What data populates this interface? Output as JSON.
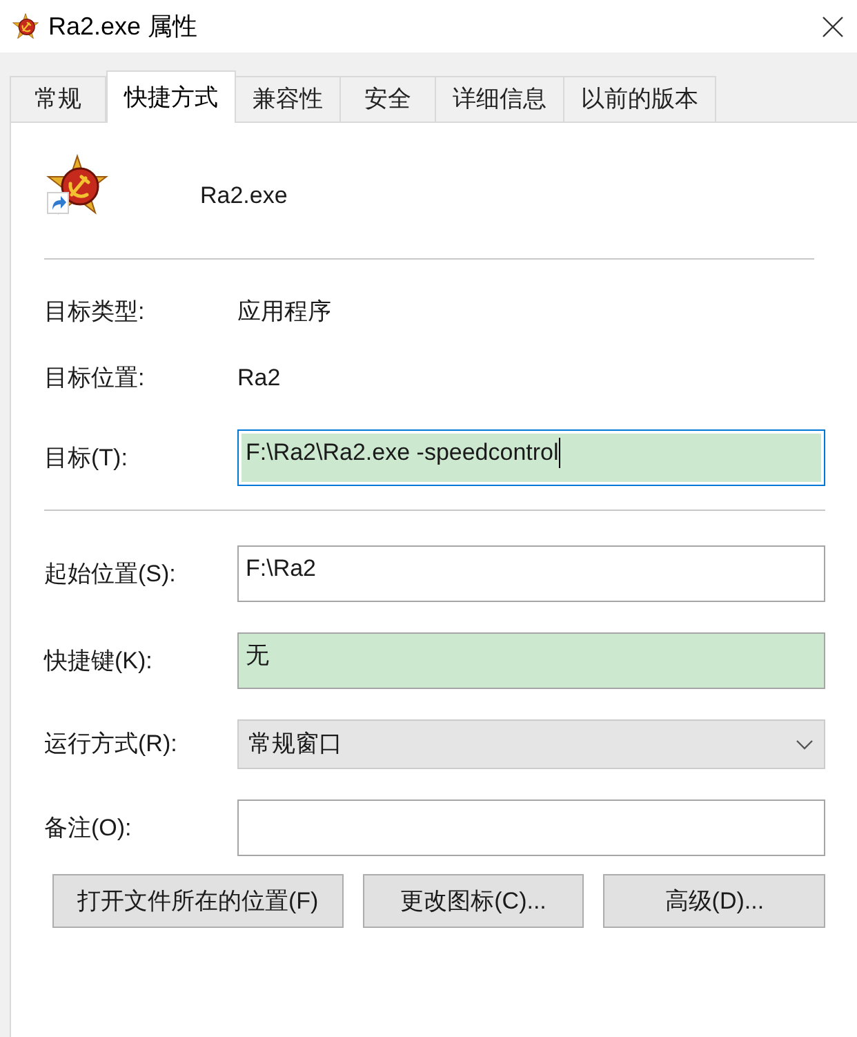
{
  "window": {
    "title": "Ra2.exe 属性"
  },
  "tabs": [
    {
      "label": "常规",
      "selected": false
    },
    {
      "label": "快捷方式",
      "selected": true
    },
    {
      "label": "兼容性",
      "selected": false
    },
    {
      "label": "安全",
      "selected": false
    },
    {
      "label": "详细信息",
      "selected": false
    },
    {
      "label": "以前的版本",
      "selected": false
    }
  ],
  "shortcut": {
    "name": "Ra2.exe"
  },
  "properties": [
    {
      "kind": "info",
      "label": "目标类型:",
      "value": "应用程序"
    },
    {
      "kind": "info",
      "label": "目标位置:",
      "value": "Ra2"
    },
    {
      "kind": "input",
      "label": "目标(T):",
      "value": "F:\\Ra2\\Ra2.exe -speedcontrol",
      "focused": true,
      "highlighted": true
    }
  ],
  "start_options": [
    {
      "kind": "input",
      "label": "起始位置(S):",
      "value": "F:\\Ra2",
      "focused": false,
      "highlighted": false
    },
    {
      "kind": "input",
      "label": "快捷键(K):",
      "value": "无",
      "focused": false,
      "highlighted": true
    },
    {
      "kind": "dropdown",
      "label": "运行方式(R):",
      "value": "常规窗口"
    },
    {
      "kind": "input",
      "label": "备注(O):",
      "focused": false,
      "highlighted": false
    }
  ],
  "buttons": [
    {
      "label": "打开文件所在的位置(F)"
    },
    {
      "label": "更改图标(C)..."
    },
    {
      "label": "高级(D)..."
    }
  ]
}
